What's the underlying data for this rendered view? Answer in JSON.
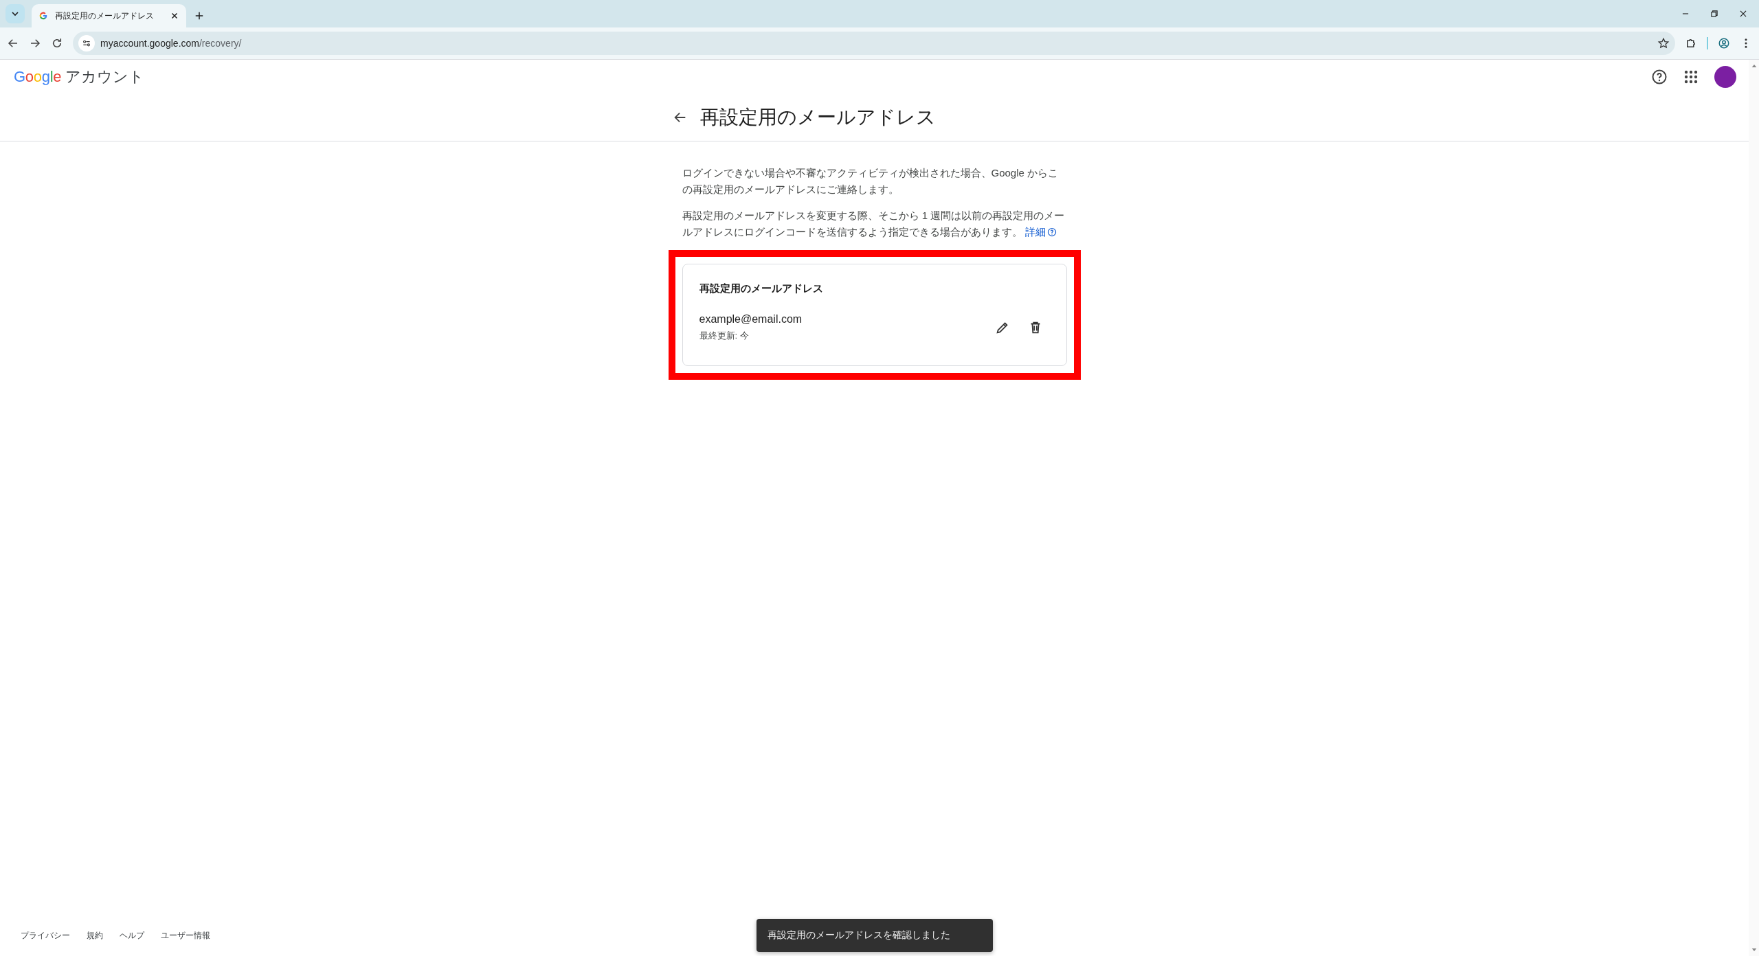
{
  "browser": {
    "tab": {
      "title": "再設定用のメールアドレス"
    },
    "url": {
      "host": "myaccount.google.com",
      "path": "/recovery/"
    }
  },
  "header": {
    "logo": "Google",
    "product": "アカウント"
  },
  "page": {
    "title": "再設定用のメールアドレス",
    "intro": "ログインできない場合や不審なアクティビティが検出された場合、Google からこの再設定用のメールアドレスにご連絡します。",
    "note": "再設定用のメールアドレスを変更する際、そこから 1 週間は以前の再設定用のメールアドレスにログインコードを送信するよう指定できる場合があります。",
    "link": "詳細"
  },
  "card": {
    "heading": "再設定用のメールアドレス",
    "email": "example@email.com",
    "updated": "最終更新: 今"
  },
  "footer": [
    "プライバシー",
    "規約",
    "ヘルプ",
    "ユーザー情報"
  ],
  "toast": "再設定用のメールアドレスを確認しました"
}
